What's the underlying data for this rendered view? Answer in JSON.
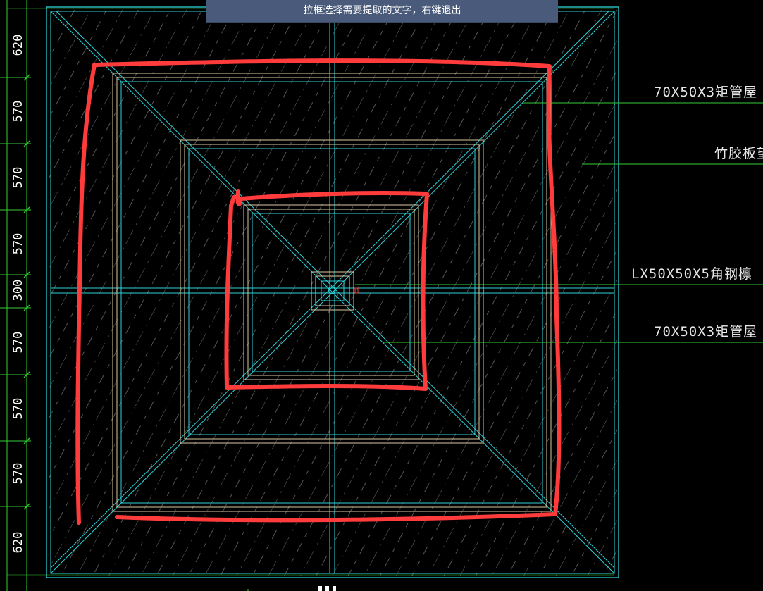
{
  "prompt": {
    "text": "拉框选择需要提取的文字，右键退出"
  },
  "dimensions": {
    "left": [
      "620",
      "570",
      "570",
      "570",
      "300",
      "570",
      "570",
      "570",
      "620"
    ]
  },
  "labels": [
    {
      "text": "70X50X3矩管屋"
    },
    {
      "text": "竹胶板望"
    },
    {
      "text": "LX50X50X5角钢檩"
    },
    {
      "text": "70X50X3矩管屋"
    }
  ],
  "colors": {
    "background": "#000000",
    "frame": "#2fd0d8",
    "inner_frame": "#d8c8a0",
    "dimension": "#33cc33",
    "leader": "#33cc33",
    "hatch": "#9a9a9a",
    "annotation": "#ff3b3b",
    "banner": "#4a5a7a"
  }
}
